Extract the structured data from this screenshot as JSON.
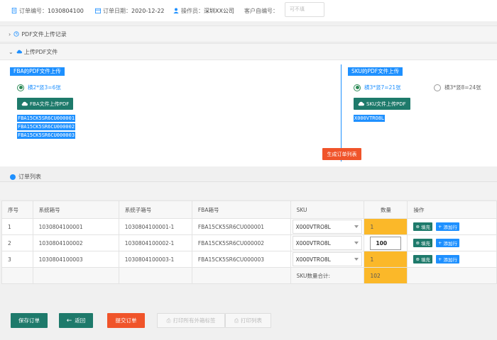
{
  "header": {
    "order_no_label": "订单编号：",
    "order_no": "1030804100",
    "order_date_label": "订单日期：",
    "order_date": "2020-12-22",
    "operator_label": "操作员：",
    "operator": "深圳XX公司",
    "customer_no_label": "客户自编号：",
    "customer_no_placeholder": "可不填"
  },
  "sections": {
    "pdf_history": "PDF文件上传记录",
    "upload_pdf": "上传PDF文件"
  },
  "fba": {
    "title": "FBA的PDF文件上传",
    "radio_label": "横2*竖3=6张",
    "upload_label": "FBA文件上传PDF",
    "files": [
      "FBA15CK5SR6CU000001",
      "FBA15CK5SR6CU000002",
      "FBA15CK5SR6CU000003"
    ]
  },
  "sku": {
    "title": "SKU的PDF文件上传",
    "radio1_label": "横3*竖7=21张",
    "radio2_label": "横3*竖8=24张",
    "upload_label": "SKU文件上传PDF",
    "files": [
      "X000VTRO8L"
    ]
  },
  "generate_button": "生成订单列表",
  "order_list": {
    "title": "订单列表",
    "columns": [
      "序号",
      "系统箱号",
      "系统子箱号",
      "FBA箱号",
      "SKU",
      "数量",
      "操作"
    ],
    "rows": [
      {
        "seq": "1",
        "box": "1030804100001",
        "subbox": "1030804100001-1",
        "fba": "FBA15CK5SR6CU000001",
        "sku": "X000VTRO8L",
        "qty": "1"
      },
      {
        "seq": "2",
        "box": "1030804100002",
        "subbox": "1030804100002-1",
        "fba": "FBA15CK5SR6CU000002",
        "sku": "X000VTRO8L",
        "qty": "100"
      },
      {
        "seq": "3",
        "box": "1030804100003",
        "subbox": "1030804100003-1",
        "fba": "FBA15CK5SR6CU000003",
        "sku": "X000VTRO8L",
        "qty": "1"
      }
    ],
    "fill_label": "填充",
    "add_row_label": "添加行",
    "sum_label": "SKU数量合计:",
    "sum_value": "102"
  },
  "buttons": {
    "save": "保存订单",
    "back": "返回",
    "submit": "提交订单",
    "print_labels": "打印所有外箱标签",
    "print_list": "打印列表"
  },
  "colors": {
    "accent_blue": "#1e90ff",
    "teal": "#1e7a6b",
    "orange_red": "#f0542a",
    "qty_yellow": "#fbb829"
  }
}
